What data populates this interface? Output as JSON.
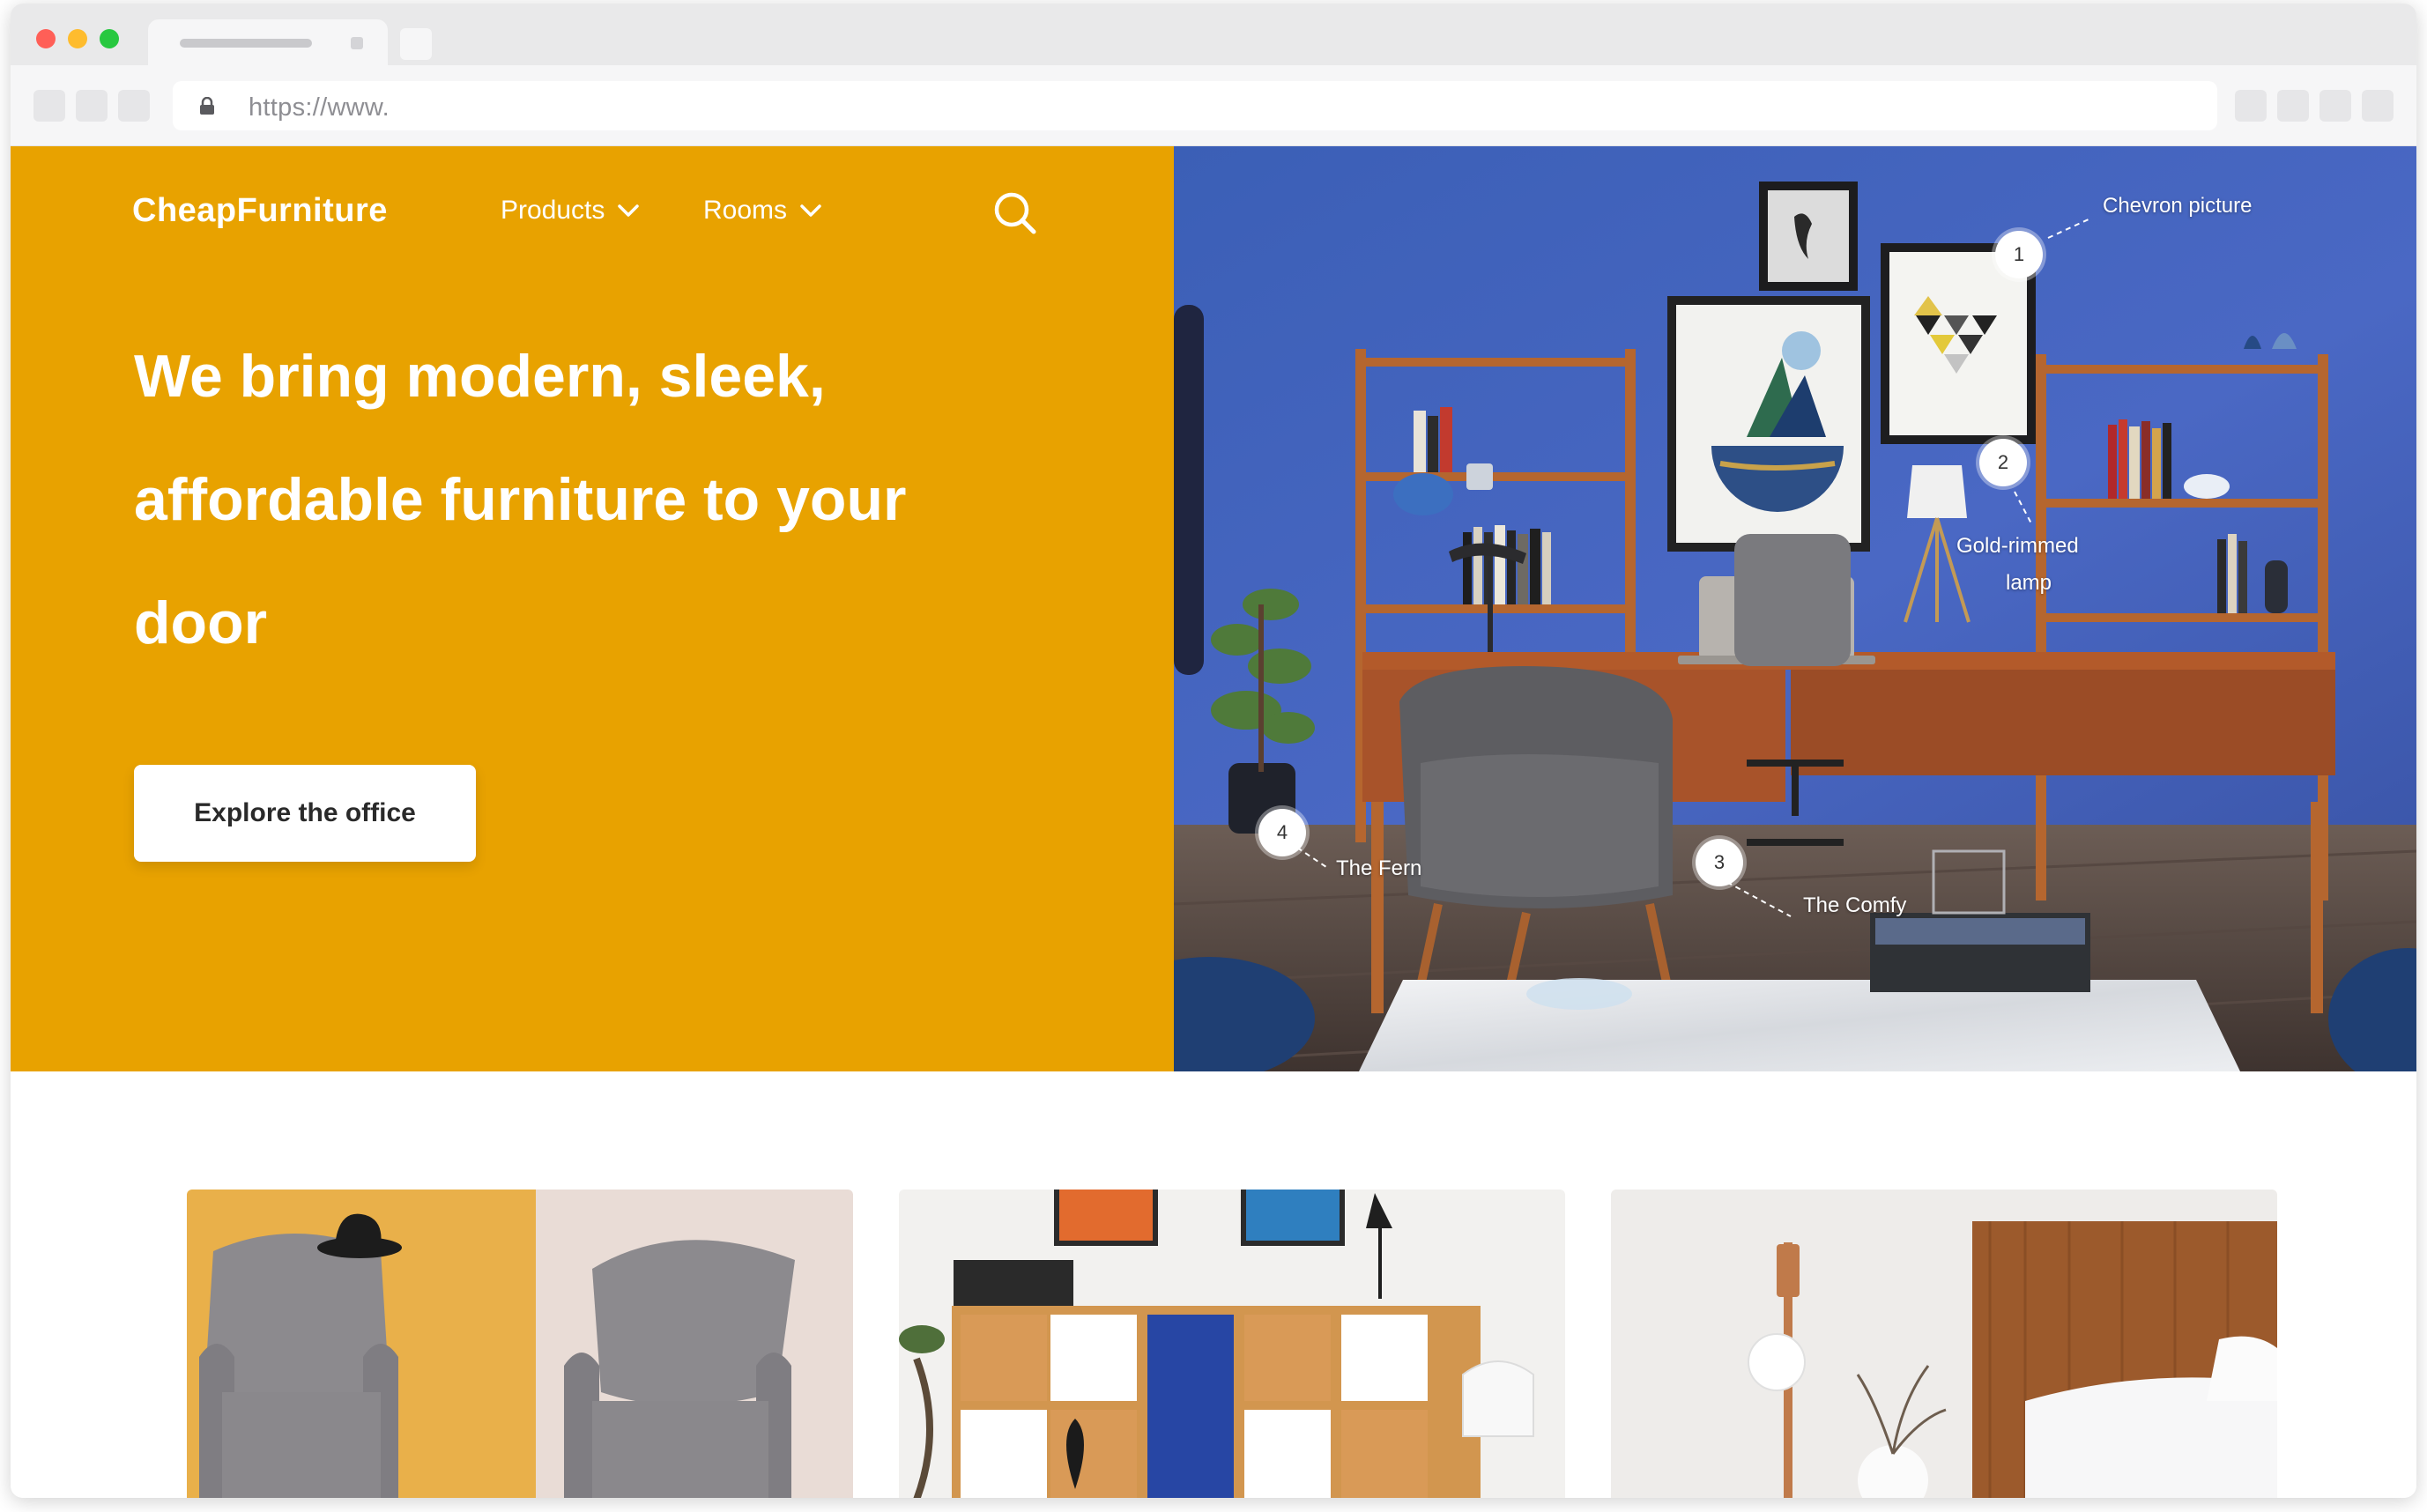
{
  "browser": {
    "url": "https://www.",
    "icons": [
      "lock-icon",
      "back-icon",
      "forward-icon",
      "reload-icon"
    ]
  },
  "site": {
    "logo": "CheapFurniture",
    "nav": {
      "products_label": "Products",
      "rooms_label": "Rooms"
    },
    "brand_color": "#e8a200"
  },
  "hero": {
    "headline_line1": "We bring modern, sleek,",
    "headline_line2": "affordable  furniture to your",
    "headline_line3": "door",
    "cta_label": "Explore the office"
  },
  "hotspots": [
    {
      "number": "1",
      "label": "Chevron picture"
    },
    {
      "number": "2",
      "label_line1": "Gold-rimmed",
      "label_line2": "lamp"
    },
    {
      "number": "3",
      "label": "The Comfy"
    },
    {
      "number": "4",
      "label": "The Fern"
    }
  ],
  "cards": [
    {
      "subject": "grey-armchairs"
    },
    {
      "subject": "storage-cabinet"
    },
    {
      "subject": "wooden-bed"
    }
  ]
}
